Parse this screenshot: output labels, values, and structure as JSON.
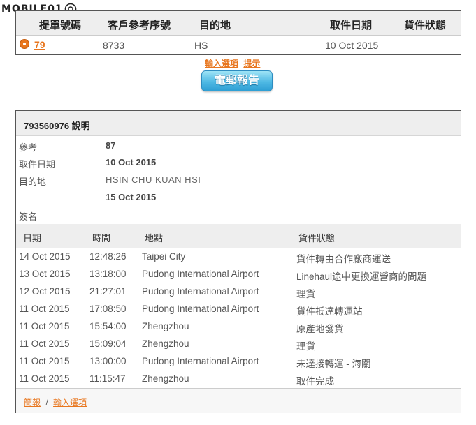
{
  "logo": {
    "text": "MOBILE01"
  },
  "shipments": {
    "headers": [
      "提單號碼",
      "客戶參考序號",
      "目的地",
      "取件日期",
      "貨件狀態"
    ],
    "row": {
      "tracking": "79",
      "reference": "8733",
      "destination": "HS",
      "pickup_date": "10 Oct 2015",
      "status": ""
    }
  },
  "options": {
    "input_options": "輸入選項",
    "hints": "提示"
  },
  "email_button": "電郵報告",
  "detail": {
    "title": "793560976 說明",
    "fields": {
      "reference_label": "參考",
      "reference_value": "87",
      "pickup_label": "取件日期",
      "pickup_value": "10 Oct 2015",
      "dest_label": "目的地",
      "dest_value": "HSIN CHU KUAN HSI",
      "delivery_value": "15 Oct 2015",
      "signature_label": "簽名"
    },
    "event_headers": {
      "date": "日期",
      "time": "時間",
      "location": "地點",
      "status": "貨件狀態"
    },
    "events": [
      {
        "date": "14 Oct 2015",
        "time": "12:48:26",
        "location": "Taipei City",
        "status": "貨件轉由合作廠商運送"
      },
      {
        "date": "13 Oct 2015",
        "time": "13:18:00",
        "location": "Pudong International Airport",
        "status": "Linehaul途中更換運營商的問題"
      },
      {
        "date": "12 Oct 2015",
        "time": "21:27:01",
        "location": "Pudong International Airport",
        "status": "理貨"
      },
      {
        "date": "11 Oct 2015",
        "time": "17:08:50",
        "location": "Pudong International Airport",
        "status": "貨件抵達轉運站"
      },
      {
        "date": "11 Oct 2015",
        "time": "15:54:00",
        "location": "Zhengzhou",
        "status": "原產地發貨"
      },
      {
        "date": "11 Oct 2015",
        "time": "15:09:04",
        "location": "Zhengzhou",
        "status": "理貨"
      },
      {
        "date": "11 Oct 2015",
        "time": "13:00:00",
        "location": "Pudong International Airport",
        "status": "未達接轉運 - 海關"
      },
      {
        "date": "11 Oct 2015",
        "time": "11:15:47",
        "location": "Zhengzhou",
        "status": "取件完成"
      }
    ],
    "footer": {
      "summary": "簡報",
      "separator": "/",
      "input_options": "輸入選項"
    }
  }
}
